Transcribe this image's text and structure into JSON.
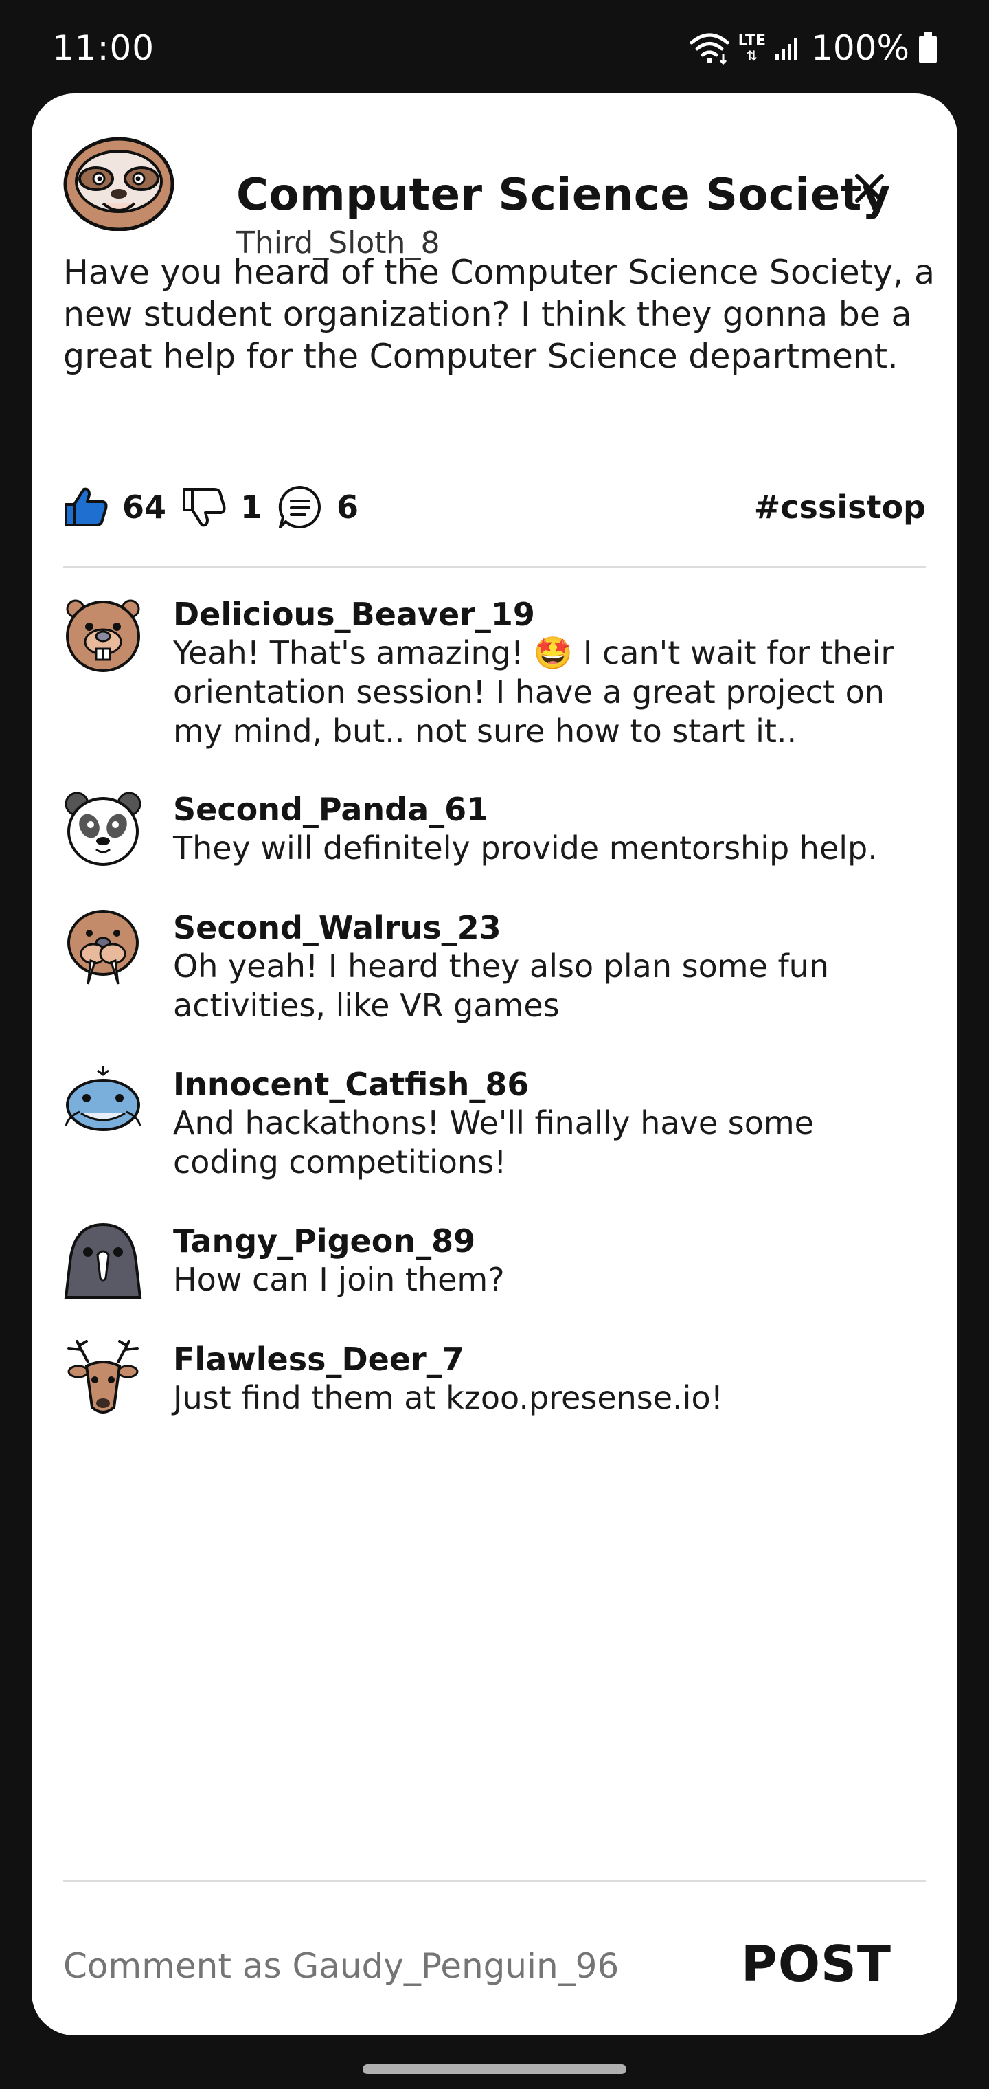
{
  "status_bar": {
    "time": "11:00",
    "network": "LTE",
    "battery": "100%"
  },
  "post": {
    "title": "Computer Science Society",
    "author": "Third_Sloth_8",
    "body": "Have you heard of the Computer Science Society, a new student organization? I think they gonna be a great help for the Computer Science department.",
    "likes": "64",
    "dislikes": "1",
    "comments_count": "6",
    "hashtag": "#cssistop"
  },
  "comments": [
    {
      "author": "Delicious_Beaver_19",
      "text": "Yeah! That's amazing! 🤩 I can't wait for their orientation session! I have a great project on my mind, but.. not sure how to start it..",
      "avatar_icon": "beaver-avatar-icon"
    },
    {
      "author": "Second_Panda_61",
      "text": "They will definitely provide mentorship help.",
      "avatar_icon": "panda-avatar-icon"
    },
    {
      "author": "Second_Walrus_23",
      "text": "Oh yeah! I heard they also plan some fun activities, like VR games",
      "avatar_icon": "walrus-avatar-icon"
    },
    {
      "author": "Innocent_Catfish_86",
      "text": "And hackathons! We'll finally have some coding competitions!",
      "avatar_icon": "catfish-avatar-icon"
    },
    {
      "author": "Tangy_Pigeon_89",
      "text": "How can I join them?",
      "avatar_icon": "pigeon-avatar-icon"
    },
    {
      "author": "Flawless_Deer_7",
      "text": "Just find them at kzoo.presense.io!",
      "avatar_icon": "deer-avatar-icon"
    }
  ],
  "composer": {
    "placeholder": "Comment as Gaudy_Penguin_96",
    "post_label": "POST"
  },
  "colors": {
    "like_blue": "#1f6fd1",
    "background": "#111111",
    "card": "#ffffff"
  }
}
